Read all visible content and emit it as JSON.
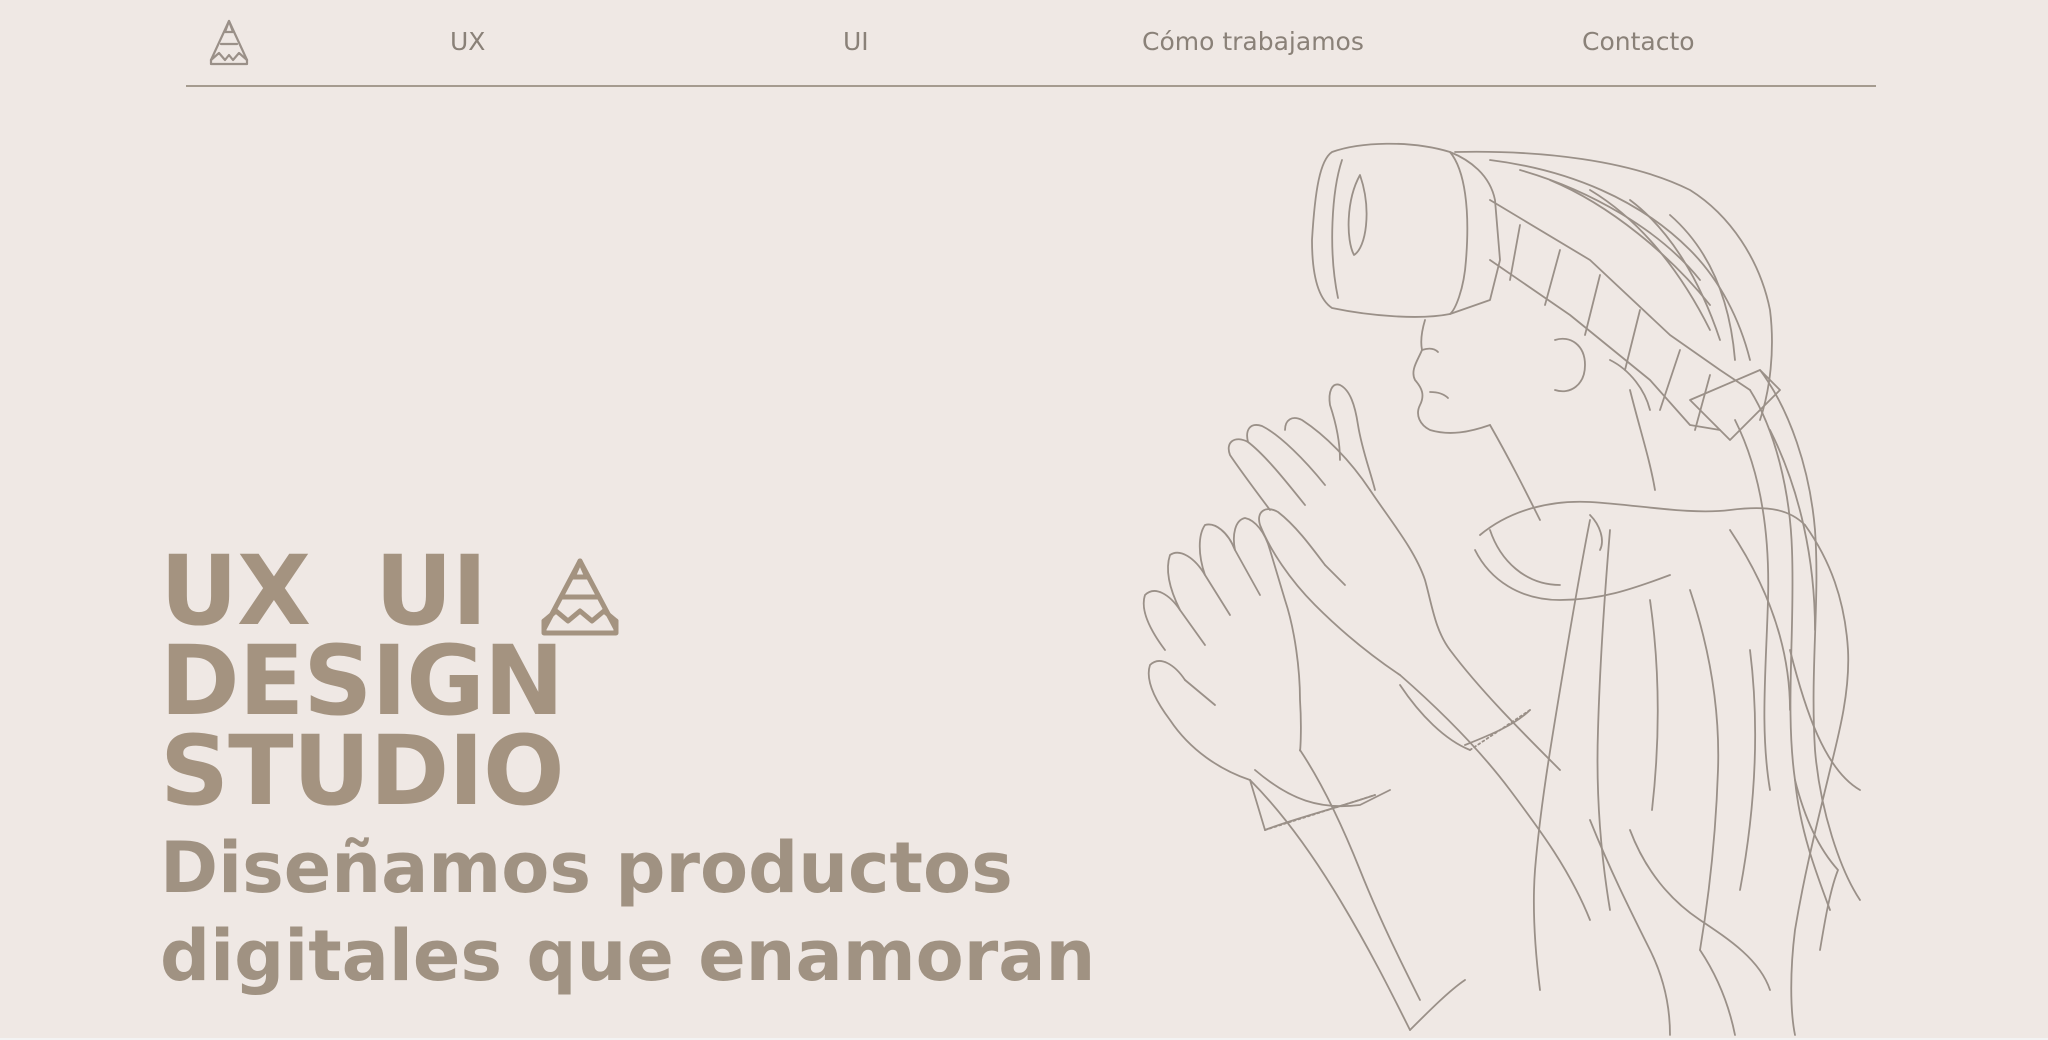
{
  "nav": {
    "links": [
      {
        "label": "UX"
      },
      {
        "label": "UI"
      },
      {
        "label": "Cómo trabajamos"
      },
      {
        "label": "Contacto"
      }
    ],
    "logo_icon": "pencil-logo-icon"
  },
  "hero": {
    "brand_lines": [
      "UX  UI",
      "DESIGN",
      "STUDIO"
    ],
    "tagline_lines": [
      "Diseñamos productos",
      "digitales que enamoran"
    ],
    "illustration_icon": "vr-headset-person-illustration"
  },
  "colors": {
    "background": "#efe8e4",
    "nav_text": "#8a8178",
    "divider": "#a59b8f",
    "brand_text": "#a49380",
    "tagline_text": "#a09282",
    "line_art": "#9a9088"
  }
}
